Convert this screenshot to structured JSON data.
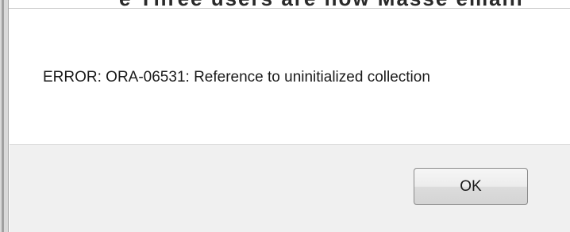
{
  "background": {
    "partial_text": "e Three users are now Masse emain"
  },
  "dialog": {
    "message": "ERROR: ORA-06531: Reference to uninitialized collection",
    "ok_label": "OK"
  }
}
